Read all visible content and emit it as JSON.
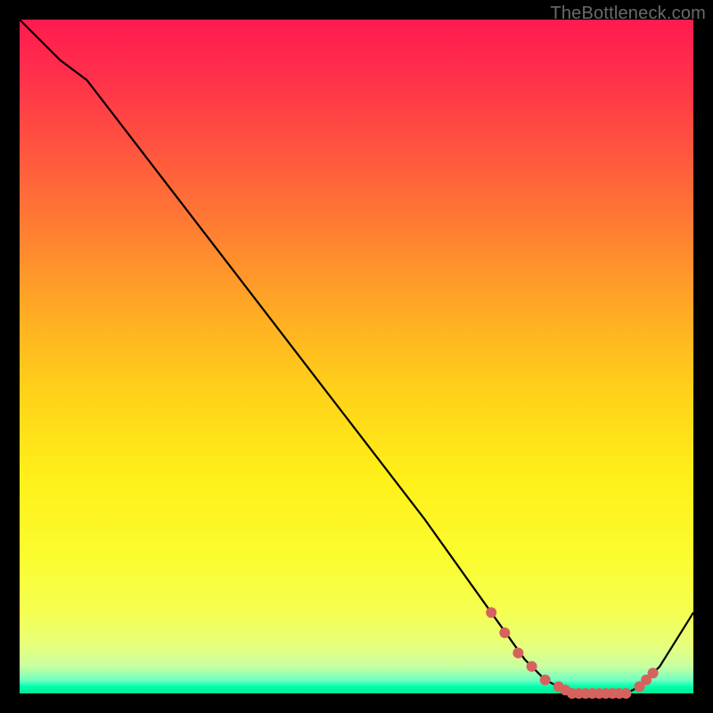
{
  "watermark": "TheBottleneck.com",
  "chart_data": {
    "type": "line",
    "title": "",
    "xlabel": "",
    "ylabel": "",
    "xlim": [
      0,
      100
    ],
    "ylim": [
      0,
      100
    ],
    "series": [
      {
        "name": "bottleneck-curve",
        "x": [
          0,
          6,
          10,
          20,
          30,
          40,
          50,
          60,
          70,
          75,
          78,
          82,
          86,
          90,
          92,
          95,
          100
        ],
        "y": [
          100,
          94,
          91,
          78,
          65,
          52,
          39,
          26,
          12,
          5,
          2,
          0,
          0,
          0,
          1,
          4,
          12
        ]
      }
    ],
    "markers": {
      "name": "highlight-dots",
      "x": [
        70,
        72,
        74,
        76,
        78,
        80,
        81,
        82,
        83,
        84,
        85,
        86,
        87,
        88,
        89,
        90,
        92,
        93,
        94
      ],
      "y": [
        12,
        9,
        6,
        4,
        2,
        1,
        0.5,
        0,
        0,
        0,
        0,
        0,
        0,
        0,
        0,
        0,
        1,
        2,
        3
      ]
    }
  }
}
